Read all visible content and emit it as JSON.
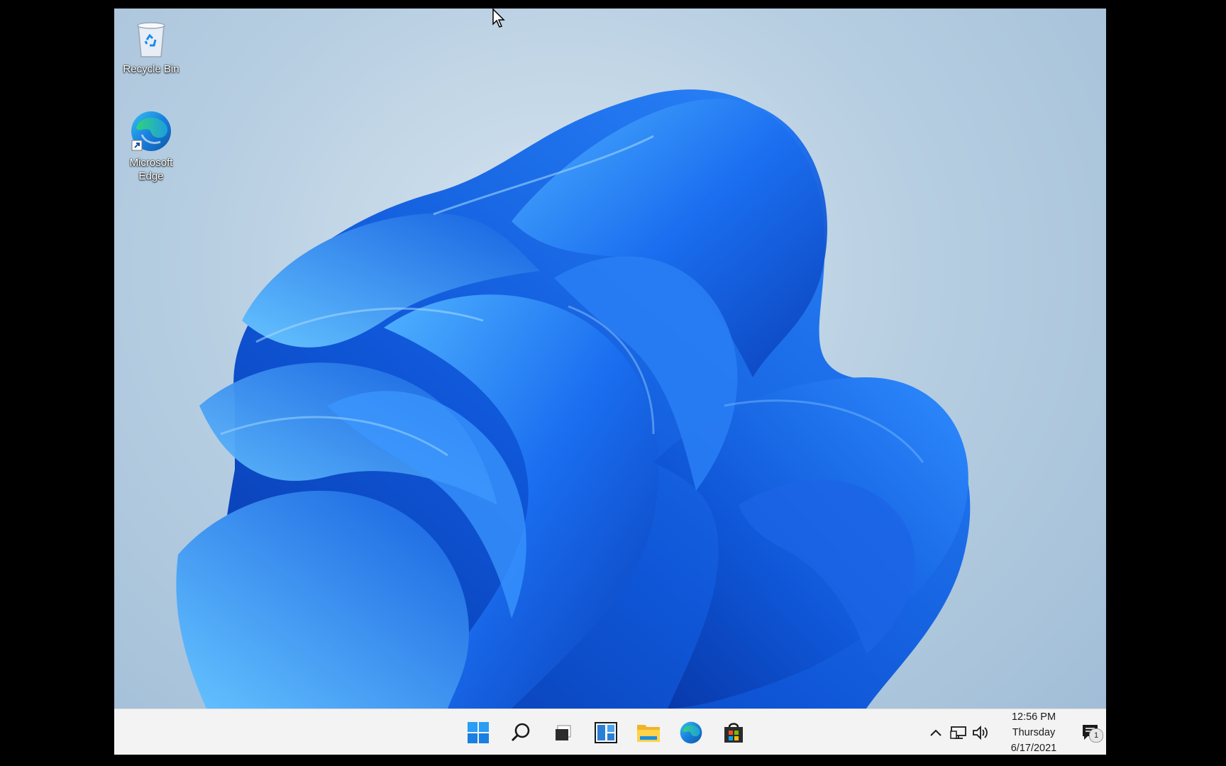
{
  "desktop": {
    "icons": [
      {
        "label": "Recycle Bin",
        "icon": "recycle-bin-icon"
      },
      {
        "label_line1": "Microsoft",
        "label_line2": "Edge",
        "icon": "edge-icon"
      }
    ]
  },
  "taskbar": {
    "apps": [
      {
        "name": "Start",
        "icon": "windows-start-icon"
      },
      {
        "name": "Search",
        "icon": "search-icon"
      },
      {
        "name": "Task View",
        "icon": "task-view-icon"
      },
      {
        "name": "Widgets",
        "icon": "widgets-icon"
      },
      {
        "name": "File Explorer",
        "icon": "file-explorer-icon"
      },
      {
        "name": "Microsoft Edge",
        "icon": "edge-icon"
      },
      {
        "name": "Microsoft Store",
        "icon": "store-icon"
      }
    ],
    "tray": {
      "icons": [
        "chevron-up-icon",
        "network-icon",
        "volume-icon"
      ],
      "clock": {
        "time": "12:56 PM",
        "day": "Thursday",
        "date": "6/17/2021"
      },
      "notification_count": "1"
    }
  },
  "colors": {
    "accent": "#0078d4",
    "wallpaper_blue": "#1f6fe8",
    "taskbar_bg": "#f3f3f3"
  }
}
